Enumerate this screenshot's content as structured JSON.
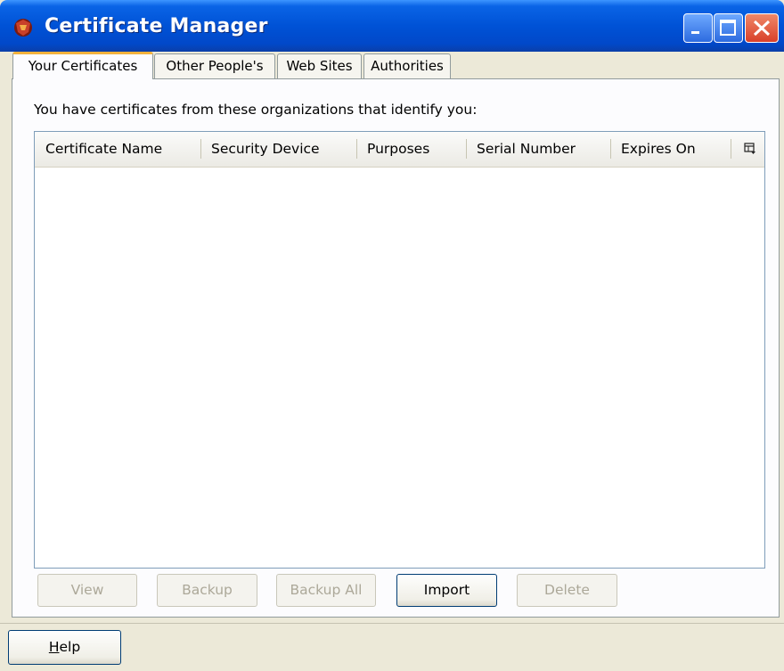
{
  "window": {
    "title": "Certificate Manager",
    "icon": "firefox-app-icon",
    "controls": [
      "minimize-icon",
      "maximize-icon",
      "close-icon"
    ]
  },
  "tabs": [
    {
      "label": "Your Certificates",
      "active": true
    },
    {
      "label": "Other People's",
      "active": false
    },
    {
      "label": "Web Sites",
      "active": false
    },
    {
      "label": "Authorities",
      "active": false
    }
  ],
  "panel": {
    "intro": "You have certificates from these organizations that identify you:",
    "columns": [
      "Certificate Name",
      "Security Device",
      "Purposes",
      "Serial Number",
      "Expires On"
    ],
    "column_picker_icon": "column-picker-icon",
    "rows": []
  },
  "buttons": {
    "view": {
      "label": "View",
      "enabled": false
    },
    "backup": {
      "label": "Backup",
      "enabled": false
    },
    "backup_all": {
      "label": "Backup All",
      "enabled": false
    },
    "import": {
      "label": "Import",
      "enabled": true
    },
    "delete": {
      "label": "Delete",
      "enabled": false
    }
  },
  "footer": {
    "help_prefix": "H",
    "help_rest": "elp"
  },
  "colors": {
    "titlebar": "#0052d6",
    "active_tab_accent": "#f2b23d",
    "close_button": "#d8402a"
  }
}
